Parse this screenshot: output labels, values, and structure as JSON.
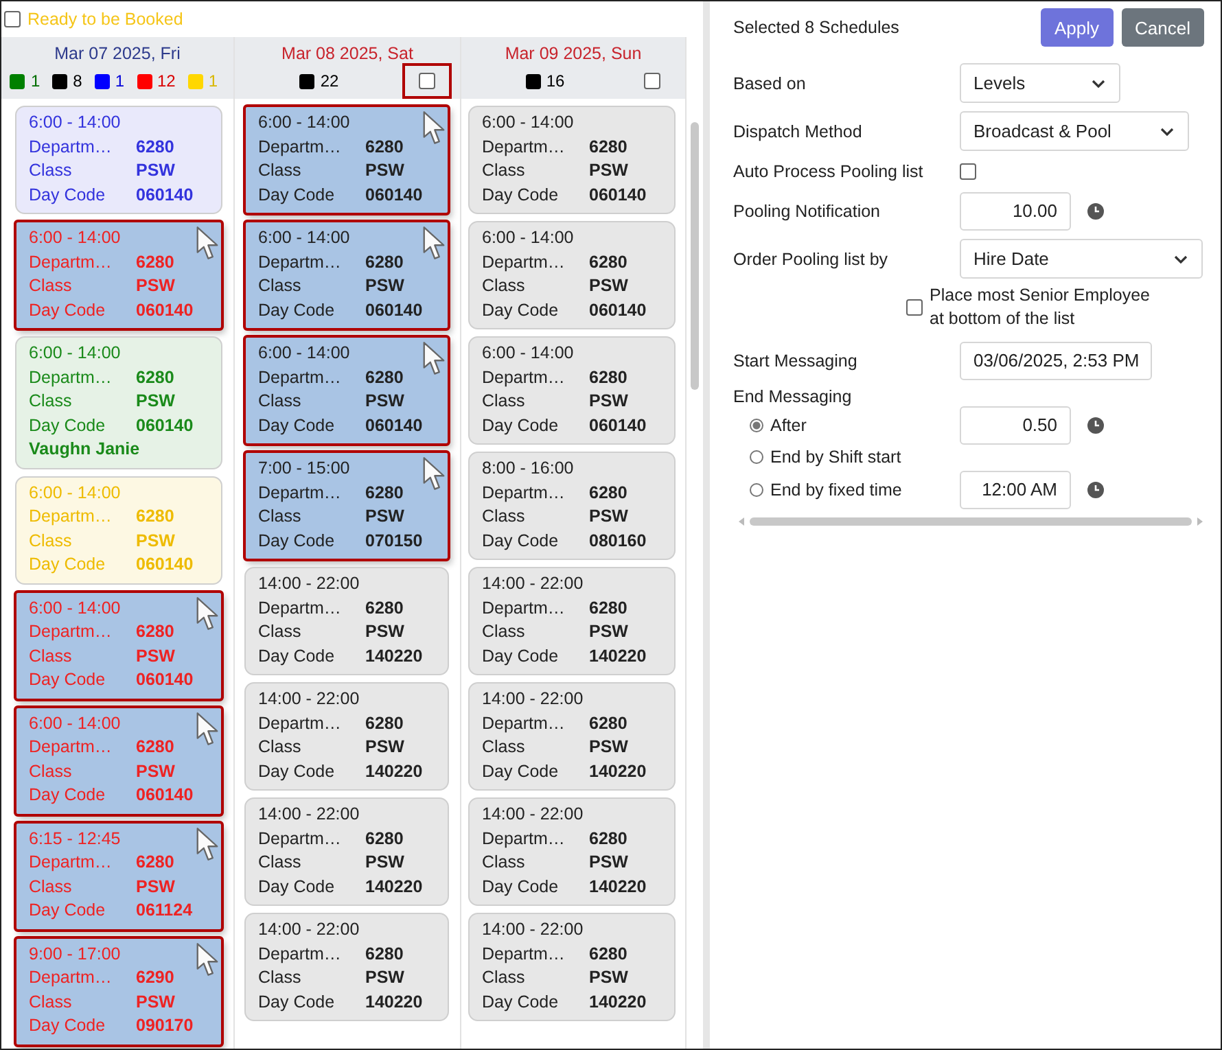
{
  "ready_filter": {
    "label": "Ready to be Booked",
    "checked": false
  },
  "days": [
    {
      "date": "Mar 07 2025, Fri",
      "weekend": false,
      "legend": [
        {
          "color": "#008000",
          "count": "1"
        },
        {
          "color": "#000000",
          "count": "8"
        },
        {
          "color": "#0000ff",
          "count": "1"
        },
        {
          "color": "#ff0000",
          "count": "12"
        },
        {
          "color": "#ffd700",
          "count": "1"
        }
      ],
      "cards": [
        {
          "time": "6:00 - 14:00",
          "color": "#3333dd",
          "selected": false,
          "rows": [
            {
              "label": "Departm…",
              "value": "6280"
            },
            {
              "label": "Class",
              "value": "PSW"
            },
            {
              "label": "Day Code",
              "value": "060140"
            }
          ]
        },
        {
          "time": "6:00 - 14:00",
          "color": "#ee2222",
          "selected": true,
          "rows": [
            {
              "label": "Departm…",
              "value": "6280"
            },
            {
              "label": "Class",
              "value": "PSW"
            },
            {
              "label": "Day Code",
              "value": "060140"
            }
          ]
        },
        {
          "time": "6:00 - 14:00",
          "color": "#1a8a1a",
          "selected": false,
          "employee": "Vaughn Janie",
          "rows": [
            {
              "label": "Departm…",
              "value": "6280"
            },
            {
              "label": "Class",
              "value": "PSW"
            },
            {
              "label": "Day Code",
              "value": "060140"
            }
          ]
        },
        {
          "time": "6:00 - 14:00",
          "color": "#eebb00",
          "selected": false,
          "rows": [
            {
              "label": "Departm…",
              "value": "6280"
            },
            {
              "label": "Class",
              "value": "PSW"
            },
            {
              "label": "Day Code",
              "value": "060140"
            }
          ]
        },
        {
          "time": "6:00 - 14:00",
          "color": "#ee2222",
          "selected": true,
          "rows": [
            {
              "label": "Departm…",
              "value": "6280"
            },
            {
              "label": "Class",
              "value": "PSW"
            },
            {
              "label": "Day Code",
              "value": "060140"
            }
          ]
        },
        {
          "time": "6:00 - 14:00",
          "color": "#ee2222",
          "selected": true,
          "rows": [
            {
              "label": "Departm…",
              "value": "6280"
            },
            {
              "label": "Class",
              "value": "PSW"
            },
            {
              "label": "Day Code",
              "value": "060140"
            }
          ]
        },
        {
          "time": "6:15 - 12:45",
          "color": "#ee2222",
          "selected": true,
          "rows": [
            {
              "label": "Departm…",
              "value": "6280"
            },
            {
              "label": "Class",
              "value": "PSW"
            },
            {
              "label": "Day Code",
              "value": "061124"
            }
          ]
        },
        {
          "time": "9:00 - 17:00",
          "color": "#ee2222",
          "selected": true,
          "rows": [
            {
              "label": "Departm…",
              "value": "6290"
            },
            {
              "label": "Class",
              "value": "PSW"
            },
            {
              "label": "Day Code",
              "value": "090170"
            }
          ]
        }
      ]
    },
    {
      "date": "Mar 08 2025, Sat",
      "weekend": true,
      "legend": [
        {
          "color": "#000000",
          "count": "22"
        }
      ],
      "checkbox": {
        "checked": false,
        "highlighted": true
      },
      "cards": [
        {
          "time": "6:00 - 14:00",
          "color": "#222222",
          "selected": true,
          "rows": [
            {
              "label": "Departm…",
              "value": "6280"
            },
            {
              "label": "Class",
              "value": "PSW"
            },
            {
              "label": "Day Code",
              "value": "060140"
            }
          ]
        },
        {
          "time": "6:00 - 14:00",
          "color": "#222222",
          "selected": true,
          "rows": [
            {
              "label": "Departm…",
              "value": "6280"
            },
            {
              "label": "Class",
              "value": "PSW"
            },
            {
              "label": "Day Code",
              "value": "060140"
            }
          ]
        },
        {
          "time": "6:00 - 14:00",
          "color": "#222222",
          "selected": true,
          "rows": [
            {
              "label": "Departm…",
              "value": "6280"
            },
            {
              "label": "Class",
              "value": "PSW"
            },
            {
              "label": "Day Code",
              "value": "060140"
            }
          ]
        },
        {
          "time": "7:00 - 15:00",
          "color": "#222222",
          "selected": true,
          "rows": [
            {
              "label": "Departm…",
              "value": "6280"
            },
            {
              "label": "Class",
              "value": "PSW"
            },
            {
              "label": "Day Code",
              "value": "070150"
            }
          ]
        },
        {
          "time": "14:00 - 22:00",
          "color": "#222222",
          "selected": false,
          "rows": [
            {
              "label": "Departm…",
              "value": "6280"
            },
            {
              "label": "Class",
              "value": "PSW"
            },
            {
              "label": "Day Code",
              "value": "140220"
            }
          ]
        },
        {
          "time": "14:00 - 22:00",
          "color": "#222222",
          "selected": false,
          "rows": [
            {
              "label": "Departm…",
              "value": "6280"
            },
            {
              "label": "Class",
              "value": "PSW"
            },
            {
              "label": "Day Code",
              "value": "140220"
            }
          ]
        },
        {
          "time": "14:00 - 22:00",
          "color": "#222222",
          "selected": false,
          "rows": [
            {
              "label": "Departm…",
              "value": "6280"
            },
            {
              "label": "Class",
              "value": "PSW"
            },
            {
              "label": "Day Code",
              "value": "140220"
            }
          ]
        },
        {
          "time": "14:00 - 22:00",
          "color": "#222222",
          "selected": false,
          "rows": [
            {
              "label": "Departm…",
              "value": "6280"
            },
            {
              "label": "Class",
              "value": "PSW"
            },
            {
              "label": "Day Code",
              "value": "140220"
            }
          ]
        }
      ]
    },
    {
      "date": "Mar 09 2025, Sun",
      "weekend": true,
      "legend": [
        {
          "color": "#000000",
          "count": "16"
        }
      ],
      "checkbox": {
        "checked": false,
        "highlighted": false
      },
      "cards": [
        {
          "time": "6:00 - 14:00",
          "color": "#222222",
          "selected": false,
          "rows": [
            {
              "label": "Departm…",
              "value": "6280"
            },
            {
              "label": "Class",
              "value": "PSW"
            },
            {
              "label": "Day Code",
              "value": "060140"
            }
          ]
        },
        {
          "time": "6:00 - 14:00",
          "color": "#222222",
          "selected": false,
          "rows": [
            {
              "label": "Departm…",
              "value": "6280"
            },
            {
              "label": "Class",
              "value": "PSW"
            },
            {
              "label": "Day Code",
              "value": "060140"
            }
          ]
        },
        {
          "time": "6:00 - 14:00",
          "color": "#222222",
          "selected": false,
          "rows": [
            {
              "label": "Departm…",
              "value": "6280"
            },
            {
              "label": "Class",
              "value": "PSW"
            },
            {
              "label": "Day Code",
              "value": "060140"
            }
          ]
        },
        {
          "time": "8:00 - 16:00",
          "color": "#222222",
          "selected": false,
          "rows": [
            {
              "label": "Departm…",
              "value": "6280"
            },
            {
              "label": "Class",
              "value": "PSW"
            },
            {
              "label": "Day Code",
              "value": "080160"
            }
          ]
        },
        {
          "time": "14:00 - 22:00",
          "color": "#222222",
          "selected": false,
          "rows": [
            {
              "label": "Departm…",
              "value": "6280"
            },
            {
              "label": "Class",
              "value": "PSW"
            },
            {
              "label": "Day Code",
              "value": "140220"
            }
          ]
        },
        {
          "time": "14:00 - 22:00",
          "color": "#222222",
          "selected": false,
          "rows": [
            {
              "label": "Departm…",
              "value": "6280"
            },
            {
              "label": "Class",
              "value": "PSW"
            },
            {
              "label": "Day Code",
              "value": "140220"
            }
          ]
        },
        {
          "time": "14:00 - 22:00",
          "color": "#222222",
          "selected": false,
          "rows": [
            {
              "label": "Departm…",
              "value": "6280"
            },
            {
              "label": "Class",
              "value": "PSW"
            },
            {
              "label": "Day Code",
              "value": "140220"
            }
          ]
        },
        {
          "time": "14:00 - 22:00",
          "color": "#222222",
          "selected": false,
          "rows": [
            {
              "label": "Departm…",
              "value": "6280"
            },
            {
              "label": "Class",
              "value": "PSW"
            },
            {
              "label": "Day Code",
              "value": "140220"
            }
          ]
        }
      ]
    }
  ],
  "panel": {
    "title": "Selected 8 Schedules",
    "buttons": [
      {
        "label": "Apply",
        "kind": "primary"
      },
      {
        "label": "Cancel",
        "kind": "secondary"
      }
    ],
    "fields": [
      {
        "kind": "select",
        "label": "Based on",
        "value": "Levels"
      },
      {
        "kind": "select",
        "label": "Dispatch Method",
        "value": "Broadcast & Pool"
      },
      {
        "kind": "checkbox",
        "label": "Auto Process Pooling list",
        "checked": false
      },
      {
        "kind": "number",
        "label": "Pooling Notification",
        "value": "10.00",
        "clock": true
      },
      {
        "kind": "select",
        "label": "Order Pooling list by",
        "value": "Hire Date"
      },
      {
        "kind": "option",
        "label": "Place most Senior Employee at bottom of the list",
        "checked": false
      },
      {
        "kind": "text",
        "label": "Start Messaging",
        "value": "03/06/2025, 2:53 PM"
      },
      {
        "kind": "heading",
        "label": "End Messaging"
      },
      {
        "kind": "radio",
        "label": "After",
        "selected": true,
        "value": "0.50",
        "clock": true
      },
      {
        "kind": "radio",
        "label": "End by Shift start",
        "selected": false
      },
      {
        "kind": "radio",
        "label": "End by fixed time",
        "selected": false,
        "value": "12:00 AM",
        "clock": true
      }
    ]
  }
}
